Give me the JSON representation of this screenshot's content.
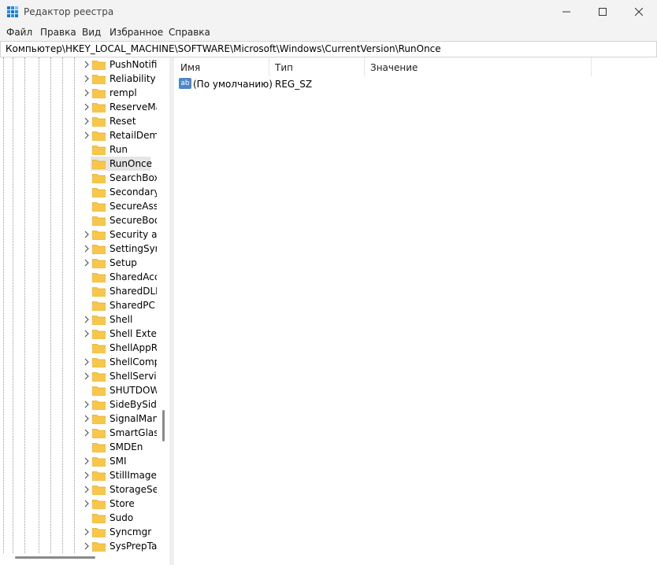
{
  "window": {
    "title": "Редактор реестра"
  },
  "menu": [
    "Файл",
    "Правка",
    "Вид",
    "Избранное",
    "Справка"
  ],
  "address": "Компьютер\\HKEY_LOCAL_MACHINE\\SOFTWARE\\Microsoft\\Windows\\CurrentVersion\\RunOnce",
  "tree": {
    "selected": "RunOnce",
    "items": [
      {
        "label": "PushNotific",
        "expandable": true
      },
      {
        "label": "Reliability",
        "expandable": true
      },
      {
        "label": "rempl",
        "expandable": true
      },
      {
        "label": "ReserveMar",
        "expandable": true
      },
      {
        "label": "Reset",
        "expandable": true
      },
      {
        "label": "RetailDemo",
        "expandable": true
      },
      {
        "label": "Run",
        "expandable": false
      },
      {
        "label": "RunOnce",
        "expandable": false
      },
      {
        "label": "SearchBoxE",
        "expandable": false
      },
      {
        "label": "SecondaryA",
        "expandable": false
      },
      {
        "label": "SecureAsse",
        "expandable": false
      },
      {
        "label": "SecureBoot",
        "expandable": false
      },
      {
        "label": "Security and",
        "expandable": true
      },
      {
        "label": "SettingSync",
        "expandable": true
      },
      {
        "label": "Setup",
        "expandable": true
      },
      {
        "label": "SharedAcce",
        "expandable": false
      },
      {
        "label": "SharedDLLs",
        "expandable": false
      },
      {
        "label": "SharedPC",
        "expandable": false
      },
      {
        "label": "Shell",
        "expandable": true
      },
      {
        "label": "Shell Extens",
        "expandable": true
      },
      {
        "label": "ShellAppRu",
        "expandable": false
      },
      {
        "label": "ShellComp",
        "expandable": true
      },
      {
        "label": "ShellService",
        "expandable": true
      },
      {
        "label": "SHUTDOW",
        "expandable": false
      },
      {
        "label": "SideBySide",
        "expandable": true
      },
      {
        "label": "SignalMana",
        "expandable": true
      },
      {
        "label": "SmartGlass",
        "expandable": true
      },
      {
        "label": "SMDEn",
        "expandable": false
      },
      {
        "label": "SMI",
        "expandable": true
      },
      {
        "label": "StillImage",
        "expandable": true
      },
      {
        "label": "StorageSen",
        "expandable": true
      },
      {
        "label": "Store",
        "expandable": true
      },
      {
        "label": "Sudo",
        "expandable": false
      },
      {
        "label": "Syncmgr",
        "expandable": true
      },
      {
        "label": "SysPrepTap",
        "expandable": true
      }
    ]
  },
  "columns": {
    "name": "Имя",
    "type": "Тип",
    "data": "Значение"
  },
  "values": [
    {
      "icon": "ab",
      "name": "(По умолчанию)",
      "type": "REG_SZ",
      "data": ""
    }
  ],
  "colors": {
    "folder": "#f8c74a",
    "folder_dark": "#e6a817",
    "selection": "#e5e5e5"
  }
}
